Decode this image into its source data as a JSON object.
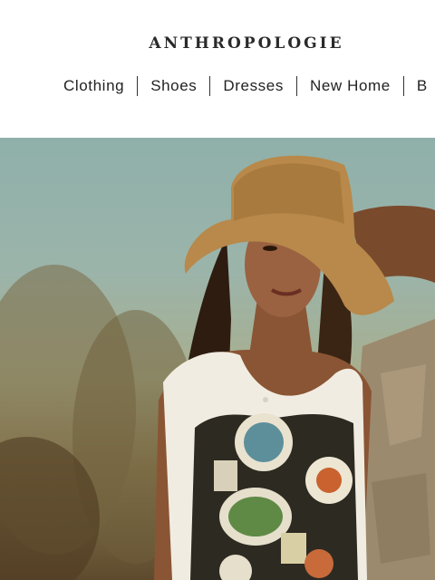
{
  "brand": {
    "logo_text": "ANTHROPOLOGIE"
  },
  "nav": {
    "items": [
      {
        "label": "Clothing"
      },
      {
        "label": "Shoes"
      },
      {
        "label": "Dresses"
      },
      {
        "label": "New Home"
      },
      {
        "label": "B"
      }
    ]
  },
  "hero": {
    "image_icon": "hero-photo"
  }
}
